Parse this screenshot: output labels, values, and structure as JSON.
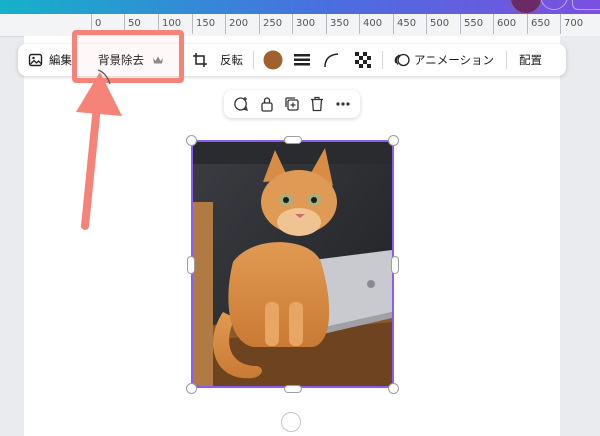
{
  "ruler": {
    "ticks": [
      "0",
      "50",
      "100",
      "150",
      "200",
      "250",
      "300",
      "350",
      "400",
      "450",
      "500",
      "550",
      "600",
      "650",
      "700"
    ]
  },
  "toolbar": {
    "edit_label": "編集",
    "bg_remove_label": "背景除去",
    "flip_label": "反転",
    "animation_label": "アニメーション",
    "position_label": "配置",
    "color_swatch": "#a0612d"
  },
  "colors": {
    "accent": "#8b5cf6",
    "highlight": "#f58378"
  }
}
